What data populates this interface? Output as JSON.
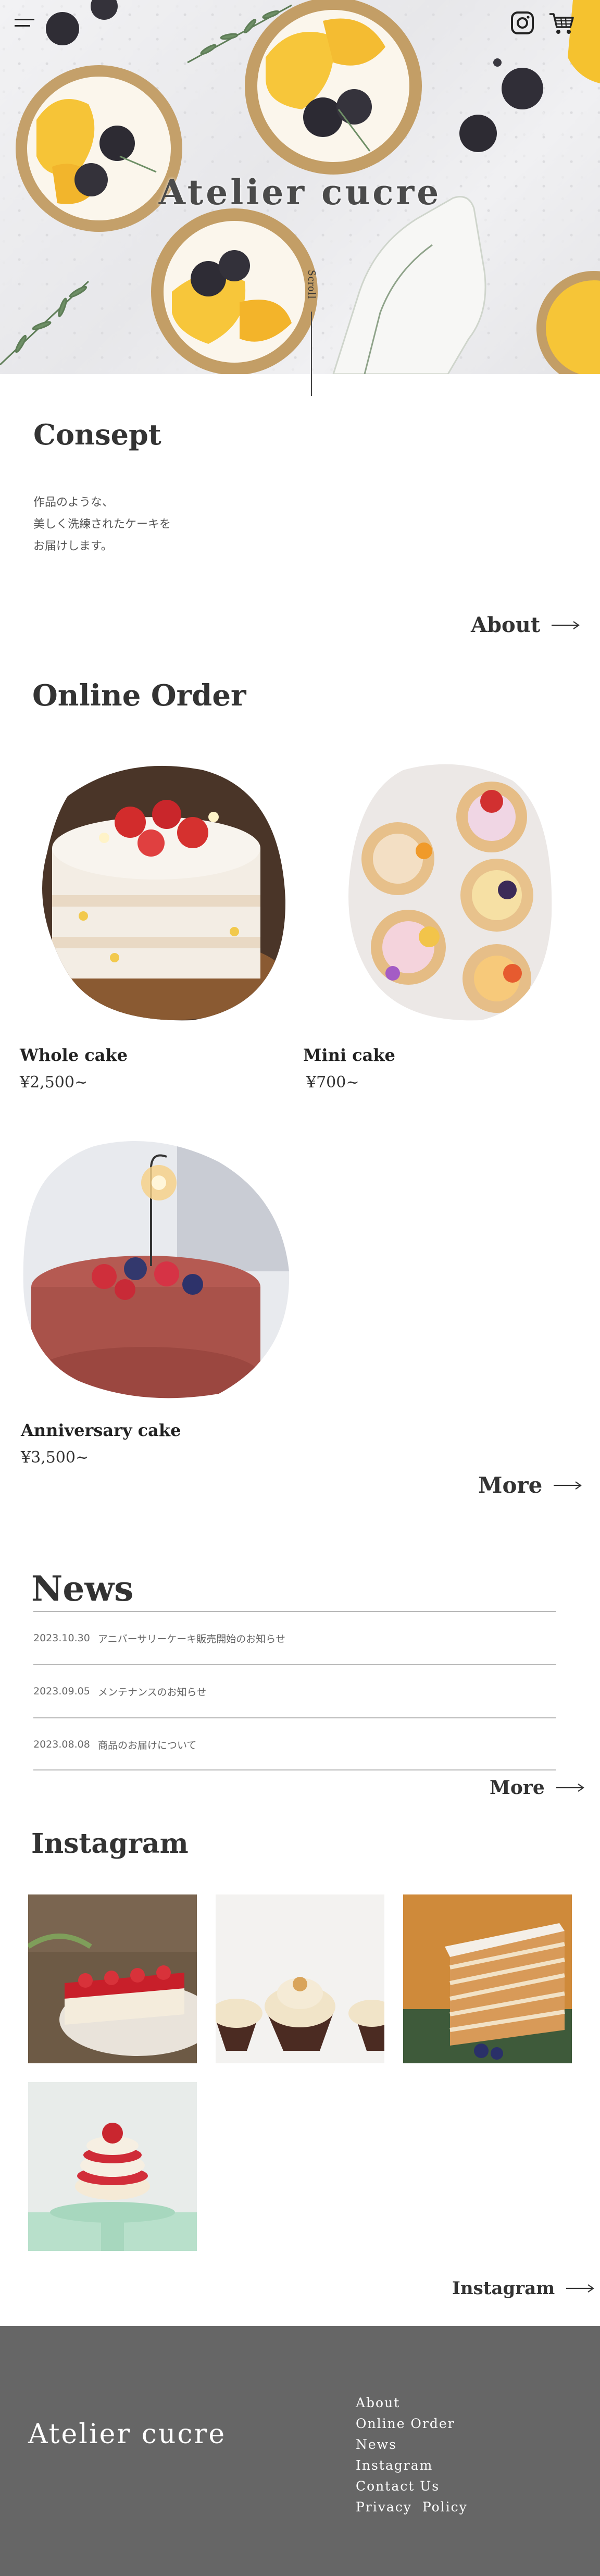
{
  "header": {
    "brand": "Atelier cucre",
    "scroll_label": "Scroll",
    "menu_icon": "hamburger-menu-icon",
    "instagram_icon": "instagram-icon",
    "cart_icon": "shopping-cart-icon"
  },
  "consept": {
    "title": "Consept",
    "lines": [
      "作品のような、",
      "美しく洗練されたケーキを",
      "お届けします。"
    ],
    "link_label": "About"
  },
  "online_order": {
    "title": "Online Order",
    "products": [
      {
        "name": "Whole cake",
        "price": "¥2,500~"
      },
      {
        "name": "Mini cake",
        "price": "¥700~"
      },
      {
        "name": "Anniversary cake",
        "price": "¥3,500~"
      }
    ],
    "link_label": "More"
  },
  "news": {
    "title": "News",
    "items": [
      {
        "date": "2023.10.30",
        "text": "アニバーサリーケーキ販売開始のお知らせ"
      },
      {
        "date": "2023.09.05",
        "text": "メンテナンスのお知らせ"
      },
      {
        "date": "2023.08.08",
        "text": "商品のお届けについて"
      }
    ],
    "link_label": "More"
  },
  "instagram": {
    "title": "Instagram",
    "link_label": "Instagram"
  },
  "footer": {
    "brand": "Atelier cucre",
    "nav": [
      "About",
      "Online Order",
      "News",
      "Instagram",
      "Contact Us",
      "Privacy  Policy"
    ]
  },
  "colors": {
    "text": "#333333",
    "footer_bg": "#666666",
    "footer_text": "#ffffff",
    "divider": "#b8b8b8"
  }
}
